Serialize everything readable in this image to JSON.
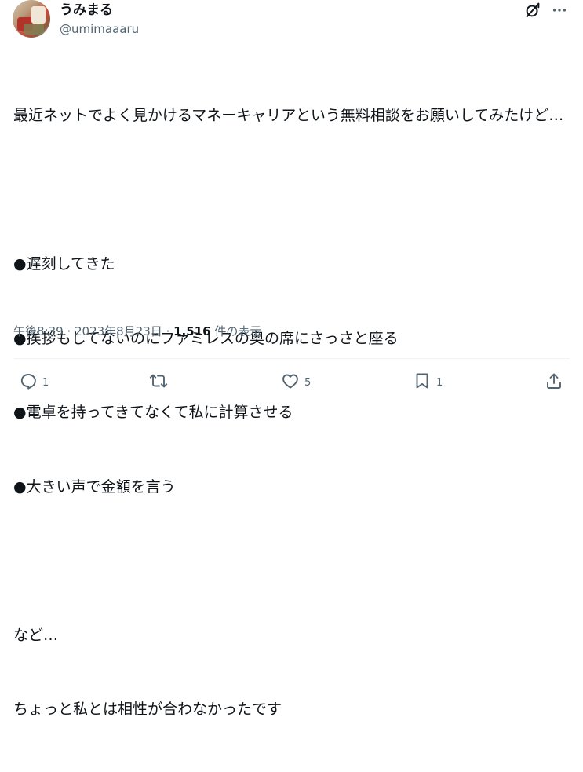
{
  "author": {
    "display_name": "うみまる",
    "handle": "@umimaaaru"
  },
  "icons": {
    "grok": "grok-icon",
    "more": "more-icon",
    "reply": "reply-icon",
    "repost": "repost-icon",
    "like": "heart-icon",
    "bookmark": "bookmark-icon",
    "share": "share-icon"
  },
  "tweet": {
    "paragraphs": [
      "最近ネットでよく見かけるマネーキャリアという無料相談をお願いしてみたけど…",
      "",
      "●遅刻してきた",
      "●挨拶もしてないのにファミレスの奥の席にさっさと座る",
      "●電卓を持ってきてなくて私に計算させる",
      "●大きい声で金額を言う",
      "",
      "など…",
      "ちょっと私とは相性が合わなかったです"
    ]
  },
  "meta": {
    "time": "午後8:39",
    "separator": " · ",
    "date": "2023年8月23日",
    "views_count": "1,516",
    "views_label": " 件の表示"
  },
  "actions": {
    "reply_count": "1",
    "repost_count": "",
    "like_count": "5",
    "bookmark_count": "1"
  },
  "colors": {
    "text": "#0f1419",
    "secondary": "#536471",
    "divider": "#eff3f4"
  }
}
